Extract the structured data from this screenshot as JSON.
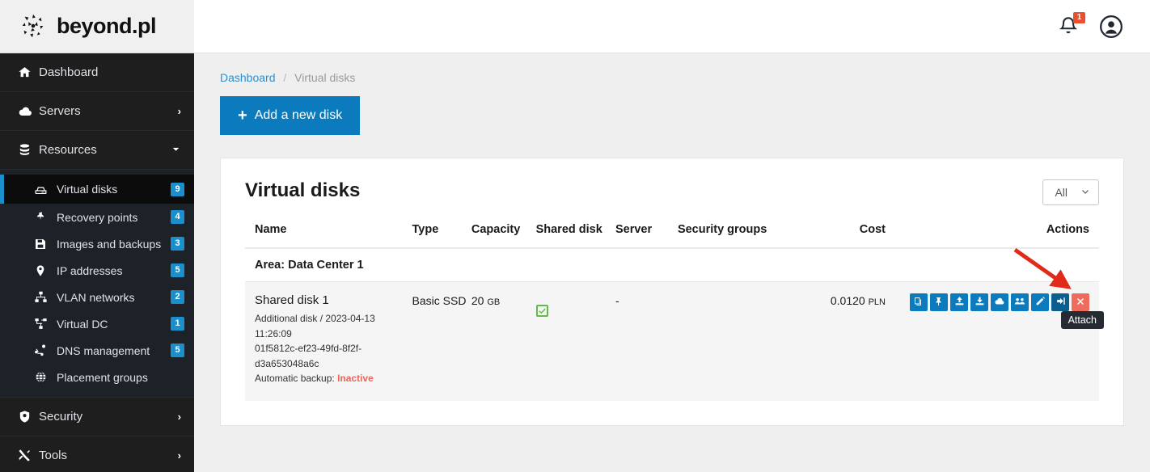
{
  "brand": {
    "name": "beyond.pl",
    "logo_icon": "beyond-particles-logo"
  },
  "topbar": {
    "notification_icon": "bell-icon",
    "notification_count": "1",
    "account_icon": "user-avatar-icon"
  },
  "sidebar": {
    "top_items": [
      {
        "label": "Dashboard",
        "icon": "home-icon",
        "chevron": ""
      },
      {
        "label": "Servers",
        "icon": "cloud-icon",
        "chevron": "›"
      },
      {
        "label": "Resources",
        "icon": "database-icon",
        "chevron": "⌄"
      }
    ],
    "sub_items": [
      {
        "label": "Virtual disks",
        "icon": "hard-drive-icon",
        "badge": "9",
        "active": true
      },
      {
        "label": "Recovery points",
        "icon": "pin-icon",
        "badge": "4",
        "active": false
      },
      {
        "label": "Images and backups",
        "icon": "floppy-save-icon",
        "badge": "3",
        "active": false
      },
      {
        "label": "IP addresses",
        "icon": "map-pin-icon",
        "badge": "5",
        "active": false
      },
      {
        "label": "VLAN networks",
        "icon": "network-sitemap-icon",
        "badge": "2",
        "active": false
      },
      {
        "label": "Virtual DC",
        "icon": "project-diagram-icon",
        "badge": "1",
        "active": false
      },
      {
        "label": "DNS management",
        "icon": "share-nodes-icon",
        "badge": "5",
        "active": false
      },
      {
        "label": "Placement groups",
        "icon": "globe-icon",
        "badge": "",
        "active": false
      }
    ],
    "bottom_items": [
      {
        "label": "Security",
        "icon": "shield-icon",
        "chevron": "›"
      },
      {
        "label": "Tools",
        "icon": "tools-icon",
        "chevron": "›"
      }
    ]
  },
  "breadcrumb": {
    "root": "Dashboard",
    "separator": "/",
    "current": "Virtual disks"
  },
  "actions_bar": {
    "add_disk_label": "Add a new disk",
    "add_disk_icon": "plus-icon"
  },
  "card": {
    "title": "Virtual disks",
    "filter_selected": "All",
    "filter_icon": "chevron-down-icon"
  },
  "table": {
    "headers": {
      "name": "Name",
      "type": "Type",
      "capacity": "Capacity",
      "shared": "Shared disk",
      "server": "Server",
      "security_groups": "Security groups",
      "cost": "Cost",
      "actions": "Actions"
    },
    "group_label": "Area: Data Center 1",
    "row": {
      "name": "Shared disk 1",
      "meta_line1": "Additional disk / 2023-04-13 11:26:09",
      "meta_line2": "01f5812c-ef23-49fd-8f2f-d3a653048a6c",
      "backup_label": "Automatic backup:",
      "backup_status": "Inactive",
      "type": "Basic SSD",
      "capacity_value": "20",
      "capacity_unit": "GB",
      "shared_checked": true,
      "shared_icon": "checkbox-checked-icon",
      "server": "-",
      "security_groups": "",
      "cost_value": "0.0120",
      "cost_unit": "PLN",
      "action_buttons": [
        {
          "name": "clone-icon",
          "title": "Clone"
        },
        {
          "name": "pin-icon",
          "title": "Pin"
        },
        {
          "name": "upload-icon",
          "title": "Upload"
        },
        {
          "name": "download-icon",
          "title": "Download"
        },
        {
          "name": "cloud-icon",
          "title": "Cloud"
        },
        {
          "name": "users-icon",
          "title": "Share"
        },
        {
          "name": "pencil-icon",
          "title": "Edit"
        },
        {
          "name": "attach-icon",
          "title": "Attach"
        },
        {
          "name": "close-x-icon",
          "title": "Delete"
        }
      ]
    }
  },
  "tooltip": {
    "text": "Attach"
  },
  "annotation": {
    "arrow_icon": "red-arrow-annotation",
    "color": "#e02b1b"
  },
  "colors": {
    "accent": "#0b7bbd",
    "sidebar_bg": "#1d2229",
    "danger": "#ef6b5e",
    "success": "#62bb46",
    "badge": "#1b8ecc"
  }
}
